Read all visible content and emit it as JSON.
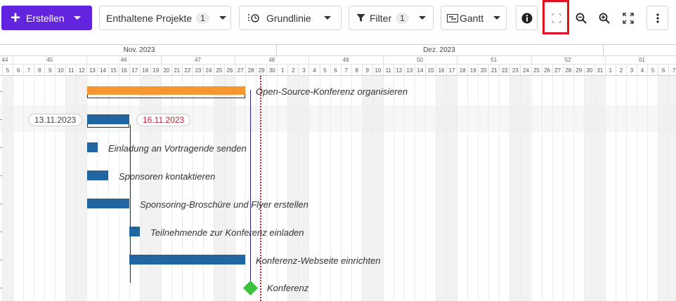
{
  "toolbar": {
    "create_label": "Erstellen",
    "projects_label": "Enthaltene Projekte",
    "projects_count": "1",
    "baseline_label": "Grundlinie",
    "filter_label": "Filter",
    "filter_count": "1",
    "view_label": "Gantt"
  },
  "timeline": {
    "months": [
      "Nov. 2023",
      "Dez. 2023"
    ],
    "weeks": [
      "44",
      "45",
      "46",
      "47",
      "48",
      "49",
      "50",
      "51",
      "52",
      "01"
    ],
    "days": [
      "5",
      "6",
      "7",
      "8",
      "9",
      "10",
      "11",
      "12",
      "13",
      "14",
      "15",
      "16",
      "17",
      "18",
      "19",
      "20",
      "21",
      "22",
      "23",
      "24",
      "25",
      "26",
      "27",
      "28",
      "29",
      "30",
      "1",
      "2",
      "3",
      "4",
      "5",
      "6",
      "7",
      "8",
      "9",
      "10",
      "11",
      "12",
      "13",
      "14",
      "15",
      "16",
      "17",
      "18",
      "19",
      "20",
      "21",
      "22",
      "23",
      "24",
      "25",
      "26",
      "27",
      "28",
      "29",
      "30",
      "31",
      "1",
      "2",
      "3",
      "4",
      "5",
      "6",
      "7"
    ]
  },
  "selection": {
    "start_date": "13.11.2023",
    "end_date": "16.11.2023"
  },
  "tasks": [
    {
      "name": "Open-Source-Konferenz organisieren",
      "type": "summary",
      "color": "#f7962f"
    },
    {
      "name": "",
      "type": "selected",
      "color": "#1f66a3"
    },
    {
      "name": "Einladung an Vortragende senden",
      "type": "task",
      "color": "#1f66a3"
    },
    {
      "name": "Sponsoren kontaktieren",
      "type": "task",
      "color": "#1f66a3"
    },
    {
      "name": "Sponsoring-Broschüre und Flyer erstellen",
      "type": "task",
      "color": "#1f66a3"
    },
    {
      "name": "Teilnehmende zur Konferenz einladen",
      "type": "task",
      "color": "#1f66a3"
    },
    {
      "name": "Konferenz-Webseite einrichten",
      "type": "task",
      "color": "#1f66a3"
    },
    {
      "name": "Konferenz",
      "type": "milestone",
      "color": "#3ec13e"
    }
  ],
  "colors": {
    "primary": "#6324e0",
    "bar": "#1f66a3",
    "summary": "#f7962f",
    "milestone": "#3ec13e",
    "today_line": "#c0262d",
    "highlight": "#e0101e"
  }
}
